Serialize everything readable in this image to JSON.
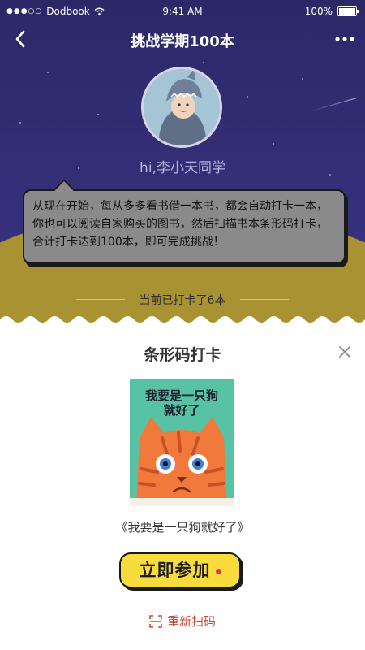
{
  "status_bar": {
    "carrier": "Dodbook",
    "time": "9:41 AM",
    "battery": "100%"
  },
  "nav": {
    "title": "挑战学期100本"
  },
  "profile": {
    "greeting": "hi,李小天同学"
  },
  "intro": {
    "text": "从现在开始，每从多多看书借一本书，都会自动打卡一本，你也可以阅读自家购买的图书，然后扫描书本条形码打卡，合计打卡达到100本，即可完成挑战！"
  },
  "progress": {
    "text": "当前已打卡了6本",
    "checked_in_count": 6
  },
  "sheet": {
    "title": "条形码打卡",
    "book": {
      "cover_title_line1": "我要是一只狗",
      "cover_title_line2": "就好了",
      "name": "《我要是一只狗就好了》"
    },
    "join_label": "立即参加",
    "rescan_label": "重新扫码"
  },
  "colors": {
    "sky": "#2f2a6e",
    "hill": "#a99232",
    "button": "#f7dc3c",
    "rescan": "#c94a35",
    "book_cover": "#57c2a4",
    "cat": "#f2793c"
  },
  "icons": {
    "back": "chevron-left-icon",
    "more": "more-dots-icon",
    "close": "close-icon",
    "scan": "scan-icon",
    "wifi": "wifi-icon",
    "battery": "battery-icon"
  }
}
